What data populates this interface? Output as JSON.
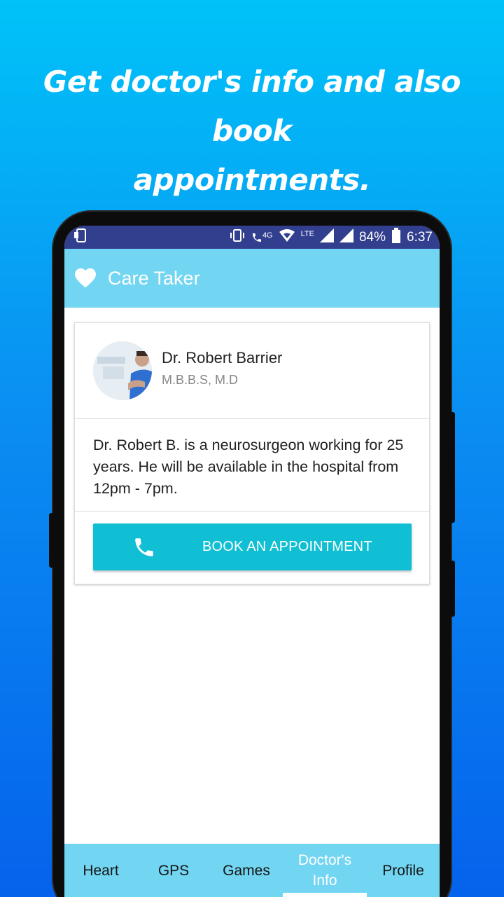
{
  "headline": {
    "line1": "Get doctor's info and also book",
    "line2": "appointments."
  },
  "statusbar": {
    "network_4g": "4G",
    "lte": "LTE",
    "battery": "84%",
    "time": "6:37"
  },
  "appbar": {
    "title": "Care Taker",
    "icon": "heart-icon"
  },
  "doctor": {
    "name": "Dr. Robert Barrier",
    "degree": "M.B.B.S, M.D",
    "description": "Dr. Robert B. is a neurosurgeon working for 25 years. He will be available in the hospital from 12pm - 7pm."
  },
  "actions": {
    "book_label": "BOOK AN APPOINTMENT",
    "book_icon": "phone-icon"
  },
  "bottom_nav": {
    "items": [
      {
        "label": "Heart"
      },
      {
        "label": "GPS"
      },
      {
        "label": "Games"
      },
      {
        "label": "Doctor's Info"
      },
      {
        "label": "Profile"
      }
    ],
    "active": "Doctor's Info"
  },
  "colors": {
    "appbar": "#72d5f2",
    "statusbar": "#323e8e",
    "button": "#10bfd4"
  }
}
